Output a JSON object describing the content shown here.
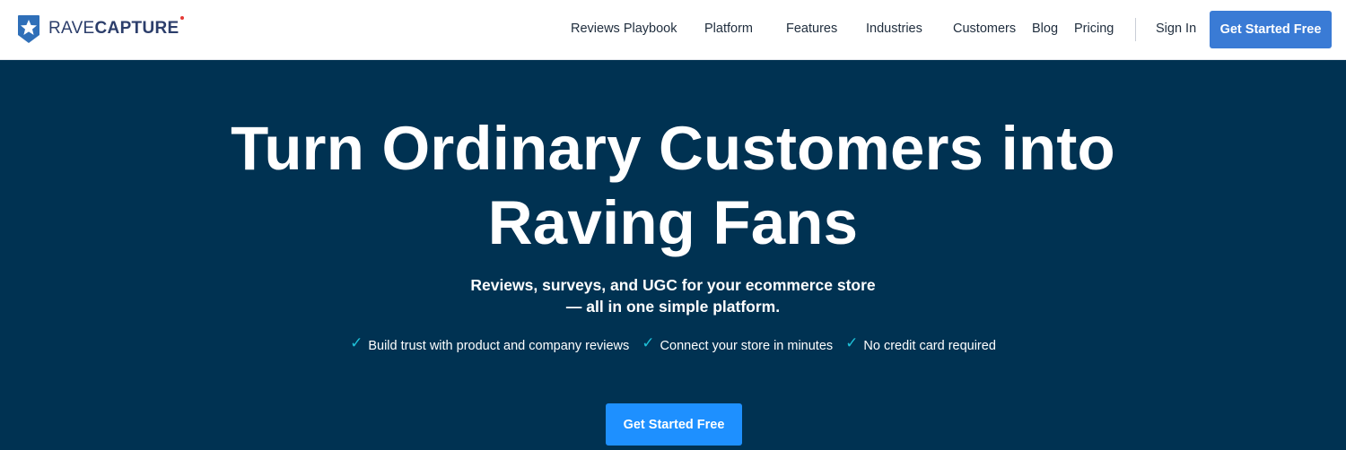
{
  "header": {
    "logo": {
      "rave": "RAVE",
      "capture": "CAPTURE"
    },
    "nav": [
      {
        "label": "Reviews Playbook"
      },
      {
        "label": "Platform"
      },
      {
        "label": "Features"
      },
      {
        "label": "Industries"
      },
      {
        "label": "Customers"
      },
      {
        "label": "Blog"
      },
      {
        "label": "Pricing"
      }
    ],
    "sign_in": "Sign In",
    "cta": "Get Started Free"
  },
  "hero": {
    "title_line1": "Turn Ordinary Customers into",
    "title_line2": "Raving Fans",
    "subtitle_line1": "Reviews, surveys, and UGC for your ecommerce store",
    "subtitle_line2": "— all in one simple platform.",
    "benefits": [
      {
        "icon": "check-icon",
        "label": "Build trust with product and company reviews"
      },
      {
        "icon": "check-icon",
        "label": "Connect your store in minutes"
      },
      {
        "icon": "check-icon",
        "label": "No credit card required"
      }
    ],
    "cta": "Get Started Free"
  },
  "colors": {
    "hero_background": "#003252",
    "header_cta": "#3a7bd5",
    "hero_cta": "#1e90ff",
    "check": "#1ec0d8",
    "logo_text": "#2c3e6b"
  }
}
